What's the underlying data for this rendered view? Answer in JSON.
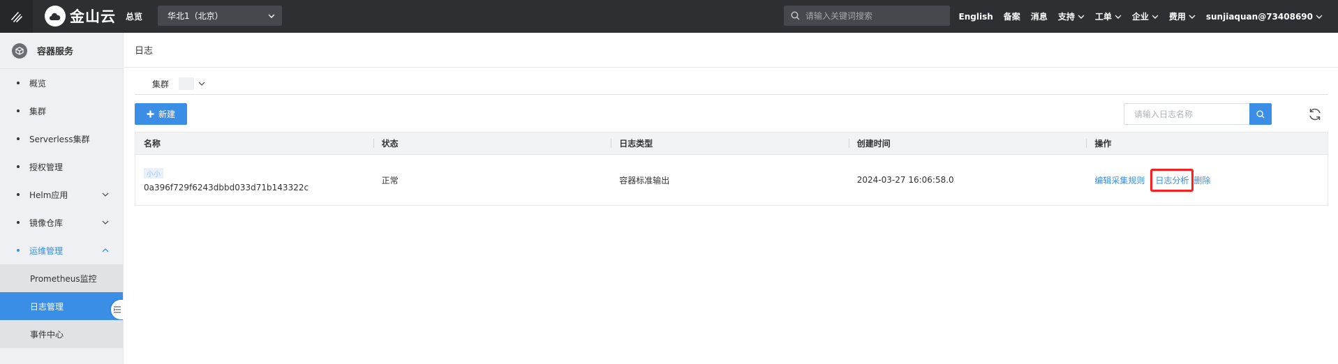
{
  "topbar": {
    "brand": "金山云",
    "overview": "总览",
    "region": "华北1（北京）",
    "search_placeholder": "请输入关键词搜索",
    "links": [
      {
        "label": "English",
        "dropdown": false
      },
      {
        "label": "备案",
        "dropdown": false
      },
      {
        "label": "消息",
        "dropdown": false
      },
      {
        "label": "支持",
        "dropdown": true
      },
      {
        "label": "工单",
        "dropdown": true
      },
      {
        "label": "企业",
        "dropdown": true
      },
      {
        "label": "费用",
        "dropdown": true
      },
      {
        "label": "sunjiaquan@73408690",
        "dropdown": true
      }
    ]
  },
  "sidebar": {
    "title": "容器服务",
    "items": [
      {
        "label": "概览"
      },
      {
        "label": "集群"
      },
      {
        "label": "Serverless集群"
      },
      {
        "label": "授权管理"
      },
      {
        "label": "Helm应用"
      },
      {
        "label": "镜像仓库"
      },
      {
        "label": "运维管理"
      }
    ],
    "sub_items": [
      {
        "label": "Prometheus监控"
      },
      {
        "label": "日志管理"
      },
      {
        "label": "事件中心"
      }
    ]
  },
  "main": {
    "title": "日志",
    "cluster_label": "集群",
    "new_button": "新建",
    "search_placeholder": "请输入日志名称",
    "columns": [
      "名称",
      "状态",
      "日志类型",
      "创建时间",
      "操作"
    ],
    "rows": [
      {
        "name_top": "小小",
        "name_id": "0a396f729f6243dbbd033d71b143322c",
        "status": "正常",
        "type": "容器标准输出",
        "created": "2024-03-27 16:06:58.0",
        "actions": [
          "编辑采集规则",
          "日志分析",
          "删除"
        ]
      }
    ]
  },
  "colors": {
    "accent": "#3a8ee6",
    "topbar": "#2d2f33",
    "highlight": "#ff1e1e"
  }
}
